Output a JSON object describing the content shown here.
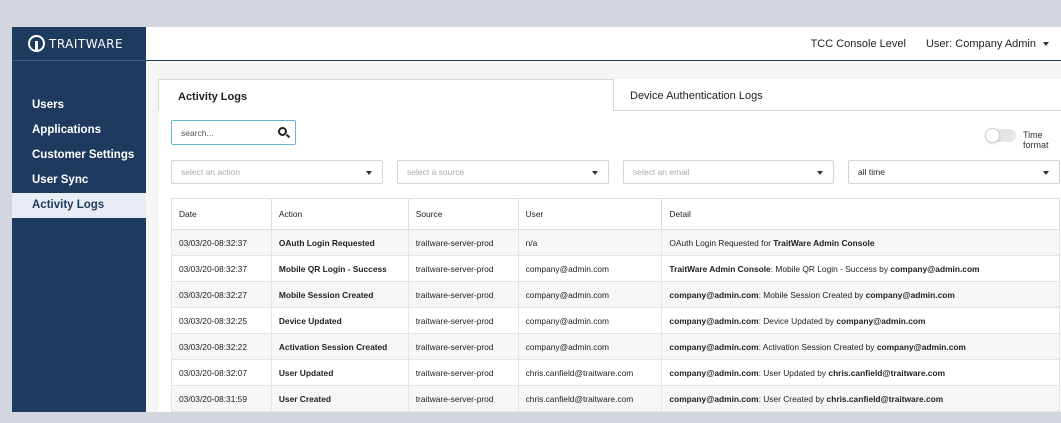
{
  "brand": {
    "name": "TRAITWARE"
  },
  "sidebar": {
    "items": [
      {
        "label": "Users"
      },
      {
        "label": "Applications"
      },
      {
        "label": "Customer Settings"
      },
      {
        "label": "User Sync"
      },
      {
        "label": "Activity Logs",
        "active": true
      }
    ]
  },
  "topbar": {
    "console_level": "TCC Console Level",
    "user": "User: Company Admin"
  },
  "tabs": {
    "activity": "Activity Logs",
    "device": "Device Authentication Logs"
  },
  "search": {
    "placeholder": "search..."
  },
  "time_format": {
    "label": "Time format",
    "enabled": false
  },
  "filters": {
    "action": "select an action",
    "source": "select a source",
    "email": "select an email",
    "time": "all time"
  },
  "table": {
    "headers": [
      "Date",
      "Action",
      "Source",
      "User",
      "Detail"
    ],
    "rows": [
      {
        "date": "03/03/20-08:32:37",
        "action": "OAuth Login Requested",
        "source": "traitware-server-prod",
        "user": "n/a",
        "d1": "",
        "d2": "OAuth Login Requested for ",
        "d3": "TraitWare Admin Console"
      },
      {
        "date": "03/03/20-08:32:37",
        "action": "Mobile QR Login - Success",
        "source": "traitware-server-prod",
        "user": "company@admin.com",
        "d1": "TraitWare Admin Console",
        "d2": ": Mobile QR Login - Success by ",
        "d3": "company@admin.com"
      },
      {
        "date": "03/03/20-08:32:27",
        "action": "Mobile Session Created",
        "source": "traitware-server-prod",
        "user": "company@admin.com",
        "d1": "company@admin.com",
        "d2": ": Mobile Session Created by ",
        "d3": "company@admin.com"
      },
      {
        "date": "03/03/20-08:32:25",
        "action": "Device Updated",
        "source": "traitware-server-prod",
        "user": "company@admin.com",
        "d1": "company@admin.com",
        "d2": ": Device Updated by ",
        "d3": "company@admin.com"
      },
      {
        "date": "03/03/20-08:32:22",
        "action": "Activation Session Created",
        "source": "traitware-server-prod",
        "user": "company@admin.com",
        "d1": "company@admin.com",
        "d2": ": Activation Session Created by ",
        "d3": "company@admin.com"
      },
      {
        "date": "03/03/20-08:32:07",
        "action": "User Updated",
        "source": "traitware-server-prod",
        "user": "chris.canfield@traitware.com",
        "d1": "company@admin.com",
        "d2": ": User Updated by ",
        "d3": "chris.canfield@traitware.com"
      },
      {
        "date": "03/03/20-08:31:59",
        "action": "User Created",
        "source": "traitware-server-prod",
        "user": "chris.canfield@traitware.com",
        "d1": "company@admin.com",
        "d2": ": User Created by ",
        "d3": "chris.canfield@traitware.com"
      }
    ]
  },
  "colors": {
    "sidebar": "#1f3a5f",
    "accent": "#67b7d1"
  }
}
